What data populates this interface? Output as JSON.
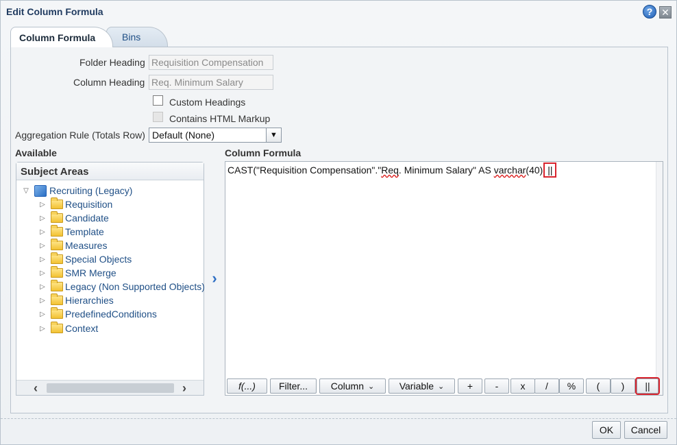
{
  "dialog": {
    "title": "Edit Column Formula"
  },
  "icons": {
    "help": "?",
    "close": "✕"
  },
  "tabs": [
    {
      "label": "Column Formula",
      "active": true
    },
    {
      "label": "Bins",
      "active": false
    }
  ],
  "form": {
    "folder_heading_label": "Folder Heading",
    "folder_heading_value": "Requisition Compensation",
    "column_heading_label": "Column Heading",
    "column_heading_value": "Req. Minimum Salary",
    "custom_headings_label": "Custom Headings",
    "custom_headings_checked": false,
    "contains_html_label": "Contains HTML Markup",
    "contains_html_checked": false,
    "aggregation_label": "Aggregation Rule (Totals Row)",
    "aggregation_value": "Default (None)"
  },
  "available": {
    "heading": "Available",
    "panel_title": "Subject Areas",
    "root": "Recruiting (Legacy)",
    "folders": [
      "Requisition",
      "Candidate",
      "Template",
      "Measures",
      "Special Objects",
      "SMR Merge",
      "Legacy (Non Supported Objects)",
      "Hierarchies",
      "PredefinedConditions",
      "Context"
    ]
  },
  "formula": {
    "heading": "Column Formula",
    "text_prefix": "CAST(\"Requisition Compensation\".\"",
    "text_spell_1": "Req",
    "text_middle": ". Minimum Salary\" AS ",
    "text_spell_2": "varchar",
    "text_suffix": "(40)",
    "highlighted_operator": "||"
  },
  "toolbar": {
    "buttons": [
      "f(...)",
      "Filter...",
      "Column",
      "Variable",
      "+",
      "-",
      "x",
      "/",
      "%",
      "(",
      ")",
      "||"
    ]
  },
  "footer": {
    "ok_label": "OK",
    "cancel_label": "Cancel"
  },
  "colors": {
    "highlight": "#d9232d",
    "link": "#1f4f86",
    "title": "#1f3a5f"
  }
}
